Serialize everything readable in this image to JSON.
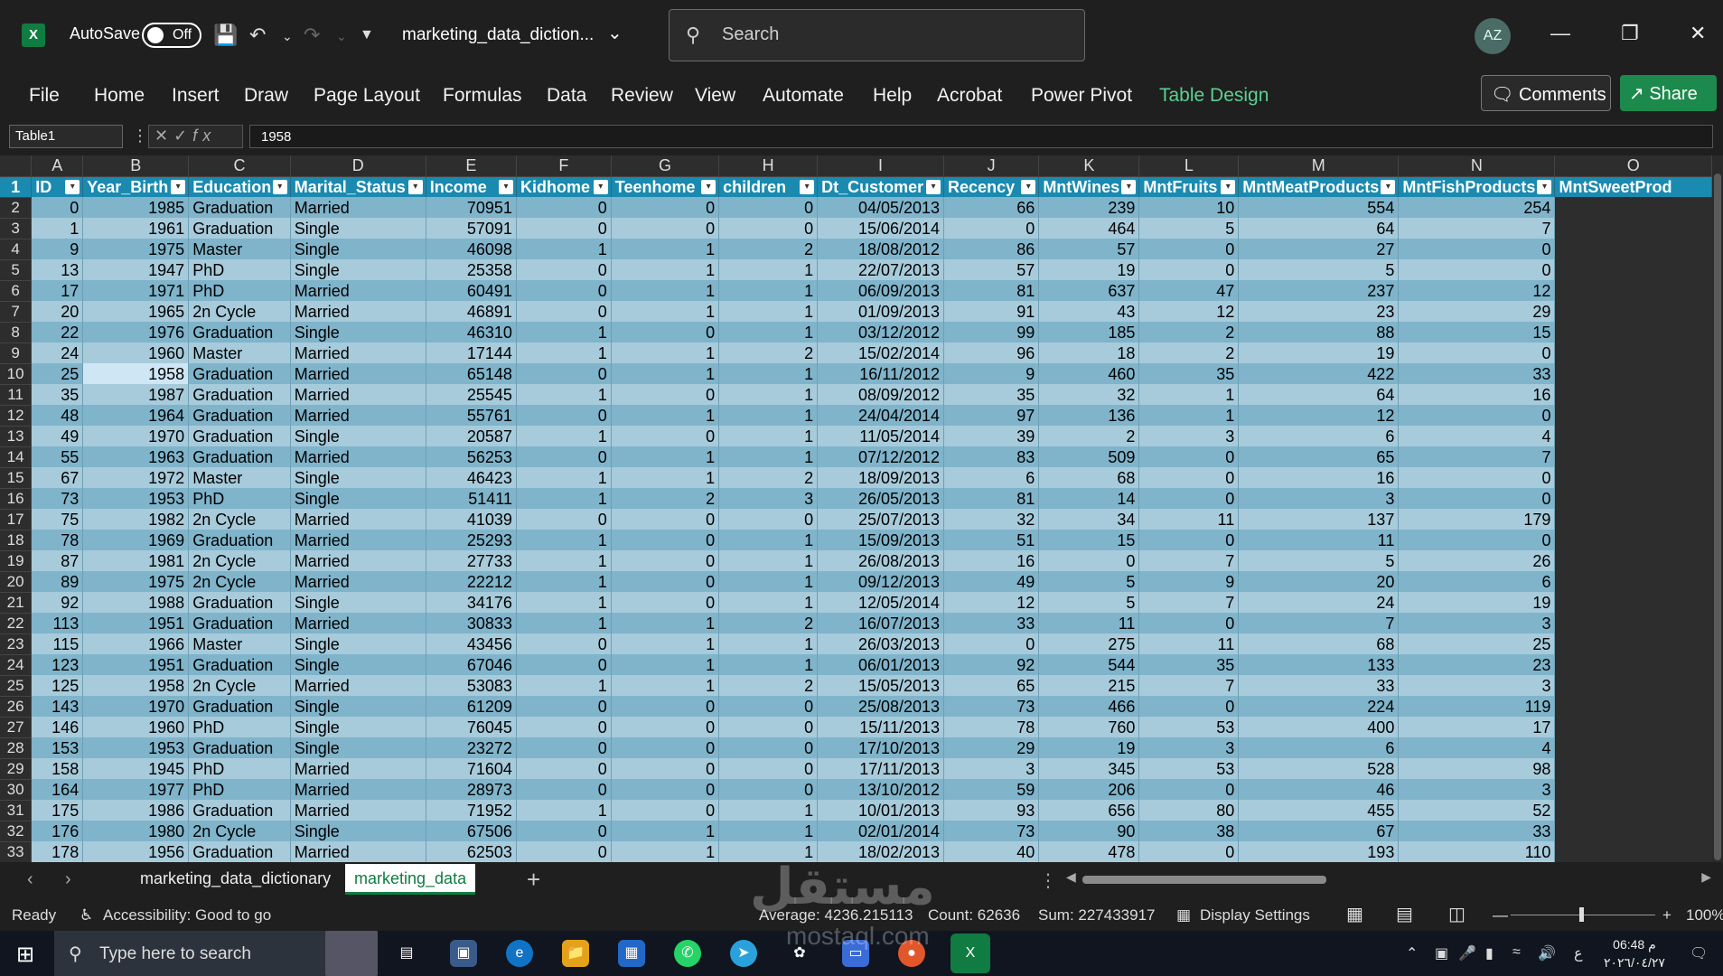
{
  "titlebar": {
    "autosave_label": "AutoSave",
    "autosave_state": "Off",
    "doc_title": "marketing_data_diction...",
    "search_placeholder": "Search",
    "avatar_initials": "AZ"
  },
  "ribbon": {
    "tabs": [
      "File",
      "Home",
      "Insert",
      "Draw",
      "Page Layout",
      "Formulas",
      "Data",
      "Review",
      "View",
      "Automate",
      "Help",
      "Acrobat",
      "Power Pivot",
      "Table Design"
    ],
    "active_tab": "Table Design",
    "comments_label": "Comments",
    "share_label": "Share"
  },
  "formula_bar": {
    "name_box": "Table1",
    "fx_label": "fx",
    "value": "1958"
  },
  "grid": {
    "col_letters": [
      "A",
      "B",
      "C",
      "D",
      "E",
      "F",
      "G",
      "H",
      "I",
      "J",
      "K",
      "L",
      "M",
      "N",
      "O"
    ],
    "headers": [
      "ID",
      "Year_Birth",
      "Education",
      "Marital_Status",
      "Income",
      "Kidhome",
      "Teenhome",
      "children",
      "Dt_Customer",
      "Recency",
      "MntWines",
      "MntFruits",
      "MntMeatProducts",
      "MntFishProducts",
      "MntSweetProd"
    ],
    "header_row_number": "1",
    "rows": [
      [
        "2",
        "0",
        "1985",
        "Graduation",
        "Married",
        "70951",
        "0",
        "0",
        "0",
        "04/05/2013",
        "66",
        "239",
        "10",
        "554",
        "254"
      ],
      [
        "3",
        "1",
        "1961",
        "Graduation",
        "Single",
        "57091",
        "0",
        "0",
        "0",
        "15/06/2014",
        "0",
        "464",
        "5",
        "64",
        "7"
      ],
      [
        "4",
        "9",
        "1975",
        "Master",
        "Single",
        "46098",
        "1",
        "1",
        "2",
        "18/08/2012",
        "86",
        "57",
        "0",
        "27",
        "0"
      ],
      [
        "5",
        "13",
        "1947",
        "PhD",
        "Single",
        "25358",
        "0",
        "1",
        "1",
        "22/07/2013",
        "57",
        "19",
        "0",
        "5",
        "0"
      ],
      [
        "6",
        "17",
        "1971",
        "PhD",
        "Married",
        "60491",
        "0",
        "1",
        "1",
        "06/09/2013",
        "81",
        "637",
        "47",
        "237",
        "12"
      ],
      [
        "7",
        "20",
        "1965",
        "2n Cycle",
        "Married",
        "46891",
        "0",
        "1",
        "1",
        "01/09/2013",
        "91",
        "43",
        "12",
        "23",
        "29"
      ],
      [
        "8",
        "22",
        "1976",
        "Graduation",
        "Single",
        "46310",
        "1",
        "0",
        "1",
        "03/12/2012",
        "99",
        "185",
        "2",
        "88",
        "15"
      ],
      [
        "9",
        "24",
        "1960",
        "Master",
        "Married",
        "17144",
        "1",
        "1",
        "2",
        "15/02/2014",
        "96",
        "18",
        "2",
        "19",
        "0"
      ],
      [
        "10",
        "25",
        "1958",
        "Graduation",
        "Married",
        "65148",
        "0",
        "1",
        "1",
        "16/11/2012",
        "9",
        "460",
        "35",
        "422",
        "33"
      ],
      [
        "11",
        "35",
        "1987",
        "Graduation",
        "Married",
        "25545",
        "1",
        "0",
        "1",
        "08/09/2012",
        "35",
        "32",
        "1",
        "64",
        "16"
      ],
      [
        "12",
        "48",
        "1964",
        "Graduation",
        "Married",
        "55761",
        "0",
        "1",
        "1",
        "24/04/2014",
        "97",
        "136",
        "1",
        "12",
        "0"
      ],
      [
        "13",
        "49",
        "1970",
        "Graduation",
        "Single",
        "20587",
        "1",
        "0",
        "1",
        "11/05/2014",
        "39",
        "2",
        "3",
        "6",
        "4"
      ],
      [
        "14",
        "55",
        "1963",
        "Graduation",
        "Married",
        "56253",
        "0",
        "1",
        "1",
        "07/12/2012",
        "83",
        "509",
        "0",
        "65",
        "7"
      ],
      [
        "15",
        "67",
        "1972",
        "Master",
        "Single",
        "46423",
        "1",
        "1",
        "2",
        "18/09/2013",
        "6",
        "68",
        "0",
        "16",
        "0"
      ],
      [
        "16",
        "73",
        "1953",
        "PhD",
        "Single",
        "51411",
        "1",
        "2",
        "3",
        "26/05/2013",
        "81",
        "14",
        "0",
        "3",
        "0"
      ],
      [
        "17",
        "75",
        "1982",
        "2n Cycle",
        "Married",
        "41039",
        "0",
        "0",
        "0",
        "25/07/2013",
        "32",
        "34",
        "11",
        "137",
        "179"
      ],
      [
        "18",
        "78",
        "1969",
        "Graduation",
        "Married",
        "25293",
        "1",
        "0",
        "1",
        "15/09/2013",
        "51",
        "15",
        "0",
        "11",
        "0"
      ],
      [
        "19",
        "87",
        "1981",
        "2n Cycle",
        "Married",
        "27733",
        "1",
        "0",
        "1",
        "26/08/2013",
        "16",
        "0",
        "7",
        "5",
        "26"
      ],
      [
        "20",
        "89",
        "1975",
        "2n Cycle",
        "Married",
        "22212",
        "1",
        "0",
        "1",
        "09/12/2013",
        "49",
        "5",
        "9",
        "20",
        "6"
      ],
      [
        "21",
        "92",
        "1988",
        "Graduation",
        "Single",
        "34176",
        "1",
        "0",
        "1",
        "12/05/2014",
        "12",
        "5",
        "7",
        "24",
        "19"
      ],
      [
        "22",
        "113",
        "1951",
        "Graduation",
        "Married",
        "30833",
        "1",
        "1",
        "2",
        "16/07/2013",
        "33",
        "11",
        "0",
        "7",
        "3"
      ],
      [
        "23",
        "115",
        "1966",
        "Master",
        "Single",
        "43456",
        "0",
        "1",
        "1",
        "26/03/2013",
        "0",
        "275",
        "11",
        "68",
        "25"
      ],
      [
        "24",
        "123",
        "1951",
        "Graduation",
        "Single",
        "67046",
        "0",
        "1",
        "1",
        "06/01/2013",
        "92",
        "544",
        "35",
        "133",
        "23"
      ],
      [
        "25",
        "125",
        "1958",
        "2n Cycle",
        "Married",
        "53083",
        "1",
        "1",
        "2",
        "15/05/2013",
        "65",
        "215",
        "7",
        "33",
        "3"
      ],
      [
        "26",
        "143",
        "1970",
        "Graduation",
        "Single",
        "61209",
        "0",
        "0",
        "0",
        "25/08/2013",
        "73",
        "466",
        "0",
        "224",
        "119"
      ],
      [
        "27",
        "146",
        "1960",
        "PhD",
        "Single",
        "76045",
        "0",
        "0",
        "0",
        "15/11/2013",
        "78",
        "760",
        "53",
        "400",
        "17"
      ],
      [
        "28",
        "153",
        "1953",
        "Graduation",
        "Single",
        "23272",
        "0",
        "0",
        "0",
        "17/10/2013",
        "29",
        "19",
        "3",
        "6",
        "4"
      ],
      [
        "29",
        "158",
        "1945",
        "PhD",
        "Married",
        "71604",
        "0",
        "0",
        "0",
        "17/11/2013",
        "3",
        "345",
        "53",
        "528",
        "98"
      ],
      [
        "30",
        "164",
        "1977",
        "PhD",
        "Married",
        "28973",
        "0",
        "0",
        "0",
        "13/10/2012",
        "59",
        "206",
        "0",
        "46",
        "3"
      ],
      [
        "31",
        "175",
        "1986",
        "Graduation",
        "Married",
        "71952",
        "1",
        "0",
        "1",
        "10/01/2013",
        "93",
        "656",
        "80",
        "455",
        "52"
      ],
      [
        "32",
        "176",
        "1980",
        "2n Cycle",
        "Single",
        "67506",
        "0",
        "1",
        "1",
        "02/01/2014",
        "73",
        "90",
        "38",
        "67",
        "33"
      ],
      [
        "33",
        "178",
        "1956",
        "Graduation",
        "Married",
        "62503",
        "0",
        "1",
        "1",
        "18/02/2013",
        "40",
        "478",
        "0",
        "193",
        "110"
      ]
    ]
  },
  "sheets": {
    "tabs": [
      "marketing_data_dictionary",
      "marketing_data"
    ],
    "active": "marketing_data"
  },
  "status": {
    "ready": "Ready",
    "accessibility": "Accessibility: Good to go",
    "average": "Average: 4236.215113",
    "count": "Count: 62636",
    "sum": "Sum: 227433917",
    "display_settings": "Display Settings",
    "zoom": "100%"
  },
  "taskbar": {
    "search_placeholder": "Type here to search",
    "time": "06:48 م",
    "date": "٢٠٢٦/٠٤/٢٧",
    "lang": "ع"
  },
  "watermark": {
    "text": "مستقل",
    "url": "mostaql.com"
  },
  "colors": {
    "table_header": "#1a8ab0",
    "band_dark": "#7fb4cb",
    "band_light": "#a7cbdb",
    "accent_green": "#5bd190",
    "share_green": "#1d8a4d"
  }
}
